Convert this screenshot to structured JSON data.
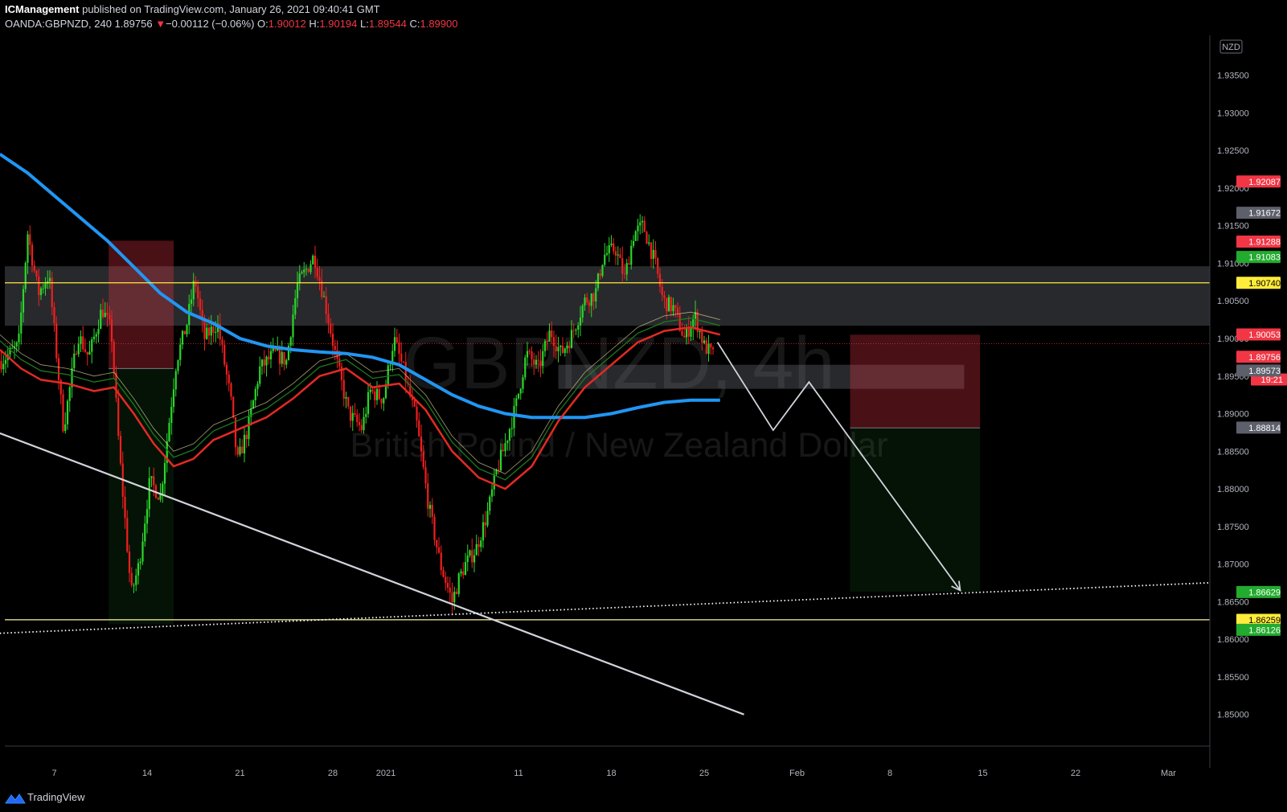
{
  "header": {
    "author": "ICManagement",
    "published": "published on TradingView.com, January 26, 2021 09:40:41 GMT",
    "symbol": "OANDA:GBPNZD, 240",
    "last": "1.89756",
    "arrow": "▼",
    "change": "−0.00112 (−0.06%)",
    "o_label": "O:",
    "o": "1.90012",
    "h_label": "H:",
    "h": "1.90194",
    "l_label": "L:",
    "l": "1.89544",
    "c_label": "C:",
    "c": "1.89900"
  },
  "watermark": {
    "symbol": "GBPNZD, 4h",
    "name": "British Pound / New Zealand Dollar"
  },
  "currency_badge": "NZD",
  "footer": {
    "brand": "TradingView"
  },
  "colors": {
    "up": "#22ab2e",
    "down": "#e3161e",
    "ema200": "#2196f3",
    "ema50": "#e32a24",
    "accent_yellow": "#ffeb3b",
    "bg": "#000000"
  },
  "chart_data": {
    "type": "candlestick",
    "title": "GBPNZD, 4h",
    "ylim": [
      1.8458,
      1.9403
    ],
    "y_ticks": [
      "1.93500",
      "1.93000",
      "1.92500",
      "1.92000",
      "1.91500",
      "1.91000",
      "1.90500",
      "1.90000",
      "1.89500",
      "1.89000",
      "1.88500",
      "1.88000",
      "1.87500",
      "1.87000",
      "1.86500",
      "1.86000",
      "1.85500",
      "1.85000"
    ],
    "x_ticks": [
      {
        "label": "7",
        "day": 7
      },
      {
        "label": "14",
        "day": 14
      },
      {
        "label": "21",
        "day": 21
      },
      {
        "label": "28",
        "day": 28
      },
      {
        "label": "2021",
        "day": 32
      },
      {
        "label": "11",
        "day": 42
      },
      {
        "label": "18",
        "day": 49
      },
      {
        "label": "25",
        "day": 56
      },
      {
        "label": "Feb",
        "day": 63
      },
      {
        "label": "8",
        "day": 70
      },
      {
        "label": "15",
        "day": 77
      },
      {
        "label": "22",
        "day": 84
      },
      {
        "label": "Mar",
        "day": 91
      }
    ],
    "price_path": [
      {
        "day": 3.0,
        "p": 1.897
      },
      {
        "day": 4.3,
        "p": 1.899
      },
      {
        "day": 5.0,
        "p": 1.914
      },
      {
        "day": 5.8,
        "p": 1.906
      },
      {
        "day": 6.6,
        "p": 1.9085
      },
      {
        "day": 7.7,
        "p": 1.888
      },
      {
        "day": 8.8,
        "p": 1.9005
      },
      {
        "day": 9.6,
        "p": 1.8975
      },
      {
        "day": 10.6,
        "p": 1.904
      },
      {
        "day": 11.3,
        "p": 1.901
      },
      {
        "day": 11.9,
        "p": 1.885
      },
      {
        "day": 12.8,
        "p": 1.866
      },
      {
        "day": 13.4,
        "p": 1.87
      },
      {
        "day": 14.2,
        "p": 1.881
      },
      {
        "day": 15.0,
        "p": 1.879
      },
      {
        "day": 16.2,
        "p": 1.897
      },
      {
        "day": 17.0,
        "p": 1.902
      },
      {
        "day": 17.6,
        "p": 1.908
      },
      {
        "day": 18.3,
        "p": 1.9
      },
      {
        "day": 19.3,
        "p": 1.902
      },
      {
        "day": 20.3,
        "p": 1.892
      },
      {
        "day": 20.8,
        "p": 1.8835
      },
      {
        "day": 21.6,
        "p": 1.888
      },
      {
        "day": 22.5,
        "p": 1.896
      },
      {
        "day": 23.6,
        "p": 1.898
      },
      {
        "day": 24.5,
        "p": 1.897
      },
      {
        "day": 25.3,
        "p": 1.907
      },
      {
        "day": 26.6,
        "p": 1.911
      },
      {
        "day": 27.5,
        "p": 1.904
      },
      {
        "day": 28.4,
        "p": 1.896
      },
      {
        "day": 29.2,
        "p": 1.89
      },
      {
        "day": 30.2,
        "p": 1.888
      },
      {
        "day": 30.8,
        "p": 1.893
      },
      {
        "day": 31.8,
        "p": 1.892
      },
      {
        "day": 32.6,
        "p": 1.9
      },
      {
        "day": 33.3,
        "p": 1.896
      },
      {
        "day": 34.3,
        "p": 1.889
      },
      {
        "day": 35.2,
        "p": 1.878
      },
      {
        "day": 36.1,
        "p": 1.87
      },
      {
        "day": 37.0,
        "p": 1.865
      },
      {
        "day": 37.5,
        "p": 1.868
      },
      {
        "day": 38.0,
        "p": 1.87
      },
      {
        "day": 38.8,
        "p": 1.872
      },
      {
        "day": 39.7,
        "p": 1.877
      },
      {
        "day": 40.3,
        "p": 1.882
      },
      {
        "day": 41.0,
        "p": 1.886
      },
      {
        "day": 41.8,
        "p": 1.891
      },
      {
        "day": 42.6,
        "p": 1.898
      },
      {
        "day": 43.5,
        "p": 1.896
      },
      {
        "day": 44.4,
        "p": 1.901
      },
      {
        "day": 45.2,
        "p": 1.898
      },
      {
        "day": 45.9,
        "p": 1.9
      },
      {
        "day": 47.0,
        "p": 1.905
      },
      {
        "day": 47.8,
        "p": 1.906
      },
      {
        "day": 48.4,
        "p": 1.911
      },
      {
        "day": 49.3,
        "p": 1.912
      },
      {
        "day": 50.0,
        "p": 1.908
      },
      {
        "day": 50.7,
        "p": 1.914
      },
      {
        "day": 51.4,
        "p": 1.915
      },
      {
        "day": 52.3,
        "p": 1.91
      },
      {
        "day": 52.9,
        "p": 1.905
      },
      {
        "day": 53.7,
        "p": 1.904
      },
      {
        "day": 54.5,
        "p": 1.9
      },
      {
        "day": 55.3,
        "p": 1.903
      },
      {
        "day": 56.0,
        "p": 1.899
      },
      {
        "day": 56.8,
        "p": 1.8975
      }
    ],
    "ema200": [
      [
        2.9,
        1.9245
      ],
      [
        5.0,
        1.922
      ],
      [
        7.0,
        1.919
      ],
      [
        9.0,
        1.916
      ],
      [
        11.0,
        1.913
      ],
      [
        13.0,
        1.9095
      ],
      [
        15.0,
        1.906
      ],
      [
        17.0,
        1.9035
      ],
      [
        19.0,
        1.902
      ],
      [
        21.0,
        1.9
      ],
      [
        23.0,
        1.899
      ],
      [
        25.0,
        1.8985
      ],
      [
        27.0,
        1.8982
      ],
      [
        29.0,
        1.898
      ],
      [
        31.0,
        1.8975
      ],
      [
        33.0,
        1.8965
      ],
      [
        35.0,
        1.8945
      ],
      [
        37.0,
        1.8925
      ],
      [
        39.0,
        1.891
      ],
      [
        41.0,
        1.89
      ],
      [
        43.0,
        1.8895
      ],
      [
        45.0,
        1.8895
      ],
      [
        47.0,
        1.8895
      ],
      [
        49.0,
        1.89
      ],
      [
        51.0,
        1.8908
      ],
      [
        53.0,
        1.8915
      ],
      [
        55.0,
        1.8918
      ],
      [
        57.2,
        1.8918
      ]
    ],
    "ema50": [
      [
        2.9,
        1.8985
      ],
      [
        4.5,
        1.896
      ],
      [
        6.0,
        1.8945
      ],
      [
        8.0,
        1.894
      ],
      [
        10.0,
        1.893
      ],
      [
        11.5,
        1.8935
      ],
      [
        13.0,
        1.89
      ],
      [
        14.5,
        1.886
      ],
      [
        16.0,
        1.883
      ],
      [
        17.5,
        1.884
      ],
      [
        19.0,
        1.8865
      ],
      [
        21.0,
        1.888
      ],
      [
        23.0,
        1.8895
      ],
      [
        25.0,
        1.892
      ],
      [
        27.0,
        1.895
      ],
      [
        29.0,
        1.896
      ],
      [
        31.0,
        1.8935
      ],
      [
        33.0,
        1.894
      ],
      [
        35.0,
        1.8905
      ],
      [
        37.0,
        1.885
      ],
      [
        39.0,
        1.8815
      ],
      [
        41.0,
        1.88
      ],
      [
        43.0,
        1.883
      ],
      [
        45.0,
        1.889
      ],
      [
        47.0,
        1.8935
      ],
      [
        49.0,
        1.8965
      ],
      [
        51.0,
        1.8995
      ],
      [
        53.0,
        1.901
      ],
      [
        55.0,
        1.9015
      ],
      [
        57.2,
        1.9005
      ]
    ],
    "resistance_zone": {
      "from": 1.9017,
      "to": 1.9096
    },
    "support_zone": {
      "from_day": 45.0,
      "to_day": 75.6,
      "from": 1.8933,
      "to": 1.8965
    },
    "h_lines": [
      {
        "p": 1.9074,
        "color": "#ffeb3b"
      },
      {
        "p": 1.8626,
        "color": "#fff59d"
      }
    ],
    "trendline": {
      "from": [
        2.9,
        1.8874
      ],
      "to": [
        59.0,
        1.85
      ]
    },
    "dotted_line": {
      "from": [
        2.9,
        1.8608
      ],
      "to": [
        98.0,
        1.8678
      ]
    },
    "projection": [
      [
        57.0,
        1.8995
      ],
      [
        61.2,
        1.8878
      ],
      [
        63.9,
        1.8942
      ],
      [
        75.3,
        1.8665
      ]
    ],
    "position_boxes": [
      {
        "x0": 11.1,
        "x1": 16.0,
        "stop": 1.913,
        "entry": 1.896,
        "target": 1.862
      },
      {
        "x0": 67.0,
        "x1": 76.8,
        "stop": 1.9005,
        "entry": 1.8881,
        "target": 1.8663
      }
    ],
    "price_labels": [
      {
        "text": "1.92087",
        "p": 1.92087,
        "bg": "#f23645",
        "fg": "#ffffff"
      },
      {
        "text": "1.91672",
        "p": 1.91672,
        "bg": "#5d606b",
        "fg": "#ffffff"
      },
      {
        "text": "1.91288",
        "p": 1.91288,
        "bg": "#f23645",
        "fg": "#ffffff"
      },
      {
        "text": "1.91083",
        "p": 1.91083,
        "bg": "#22ab2e",
        "fg": "#ffffff"
      },
      {
        "text": "1.90740",
        "p": 1.9074,
        "bg": "#ffeb3b",
        "fg": "#000000"
      },
      {
        "text": "1.90053",
        "p": 1.90053,
        "bg": "#f23645",
        "fg": "#ffffff"
      },
      {
        "text": "1.89756",
        "p": 1.89756,
        "bg": "#f23645",
        "fg": "#ffffff"
      },
      {
        "text": "19:21",
        "p": 1.89583,
        "bg": "#f23645",
        "fg": "#ffffff"
      },
      {
        "text": "1.89573",
        "p": 1.89573,
        "bg": "#5d606b",
        "fg": "#ffffff"
      },
      {
        "text": "1.88814",
        "p": 1.88814,
        "bg": "#5d606b",
        "fg": "#ffffff"
      },
      {
        "text": "1.86629",
        "p": 1.86629,
        "bg": "#22ab2e",
        "fg": "#ffffff"
      },
      {
        "text": "1.86259",
        "p": 1.86259,
        "bg": "#ffeb3b",
        "fg": "#000000"
      },
      {
        "text": "1.86126",
        "p": 1.86126,
        "bg": "#22ab2e",
        "fg": "#ffffff"
      }
    ]
  }
}
